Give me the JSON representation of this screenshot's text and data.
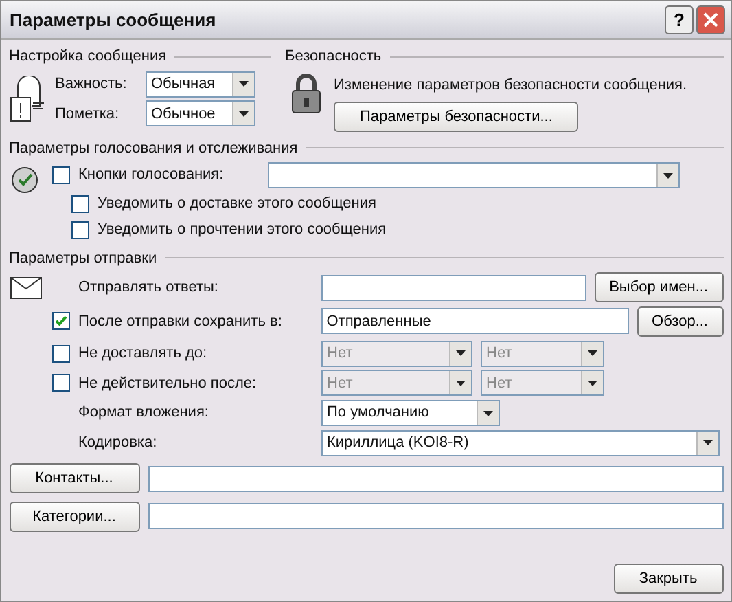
{
  "window": {
    "title": "Параметры сообщения",
    "help": "?"
  },
  "message_settings": {
    "title": "Настройка сообщения",
    "fields": [
      {
        "label": "Важность:",
        "value": "Обычная"
      },
      {
        "label": "Пометка:",
        "value": "Обычное"
      }
    ]
  },
  "security": {
    "title": "Безопасность",
    "text": "Изменение параметров безопасности сообщения.",
    "button": "Параметры безопасности..."
  },
  "voting": {
    "title": "Параметры голосования и отслеживания",
    "rows": [
      {
        "kind": "combo",
        "label": "Кнопки голосования:",
        "checked": false
      },
      {
        "kind": "check",
        "label": "Уведомить о доставке этого сообщения",
        "checked": false
      },
      {
        "kind": "check",
        "label": "Уведомить о прочтении этого сообщения",
        "checked": false
      }
    ]
  },
  "delivery": {
    "title": "Параметры отправки",
    "rows": [
      {
        "kind": "field",
        "label": "Отправлять ответы:",
        "button": "Выбор имен..."
      },
      {
        "kind": "save",
        "label": "После отправки сохранить в:",
        "checked": true,
        "value": "Отправленные",
        "button": "Обзор..."
      },
      {
        "kind": "datetime",
        "label": "Не доставлять до:",
        "checked": false,
        "date": "Нет",
        "time": "Нет"
      },
      {
        "kind": "datetime",
        "label": "Не действительно после:",
        "checked": false,
        "date": "Нет",
        "time": "Нет"
      },
      {
        "kind": "select",
        "label": "Формат вложения:",
        "value": "По умолчанию"
      },
      {
        "kind": "wide_select",
        "label": "Кодировка:",
        "value": "Кириллица (KOI8-R)"
      }
    ]
  },
  "links": [
    {
      "button": "Контакты..."
    },
    {
      "button": "Категории..."
    }
  ],
  "buttons": [
    "Закрыть"
  ]
}
